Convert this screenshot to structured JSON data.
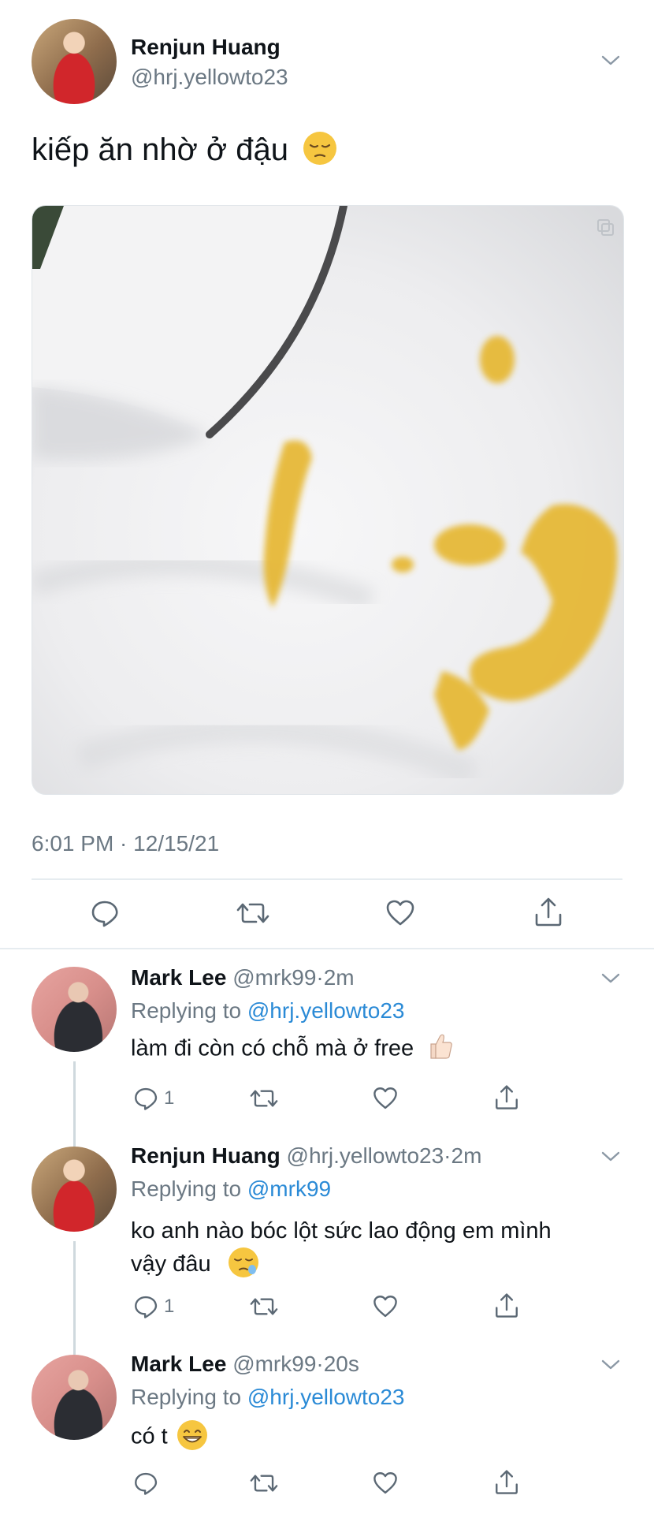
{
  "main_tweet": {
    "author_name": "Renjun Huang",
    "handle": "@hrj.yellowto23",
    "text": "kiếp ăn nhờ ở đậu",
    "emoji": "pensive-face",
    "timestamp": "6:01 PM · 12/15/21"
  },
  "replies": [
    {
      "author_name": "Mark Lee",
      "handle": "@mrk99",
      "time": "2m",
      "replying_label": "Replying to",
      "replying_to": "@hrj.yellowto23",
      "text": "làm đi còn có chỗ mà ở free",
      "emoji": "thumbs-up",
      "reply_count": "1"
    },
    {
      "author_name": "Renjun Huang",
      "handle": "@hrj.yellowto23",
      "time": "2m",
      "replying_label": "Replying to",
      "replying_to": "@mrk99",
      "text_line1": "ko anh nào bóc lột sức lao động em mình",
      "text_line2": "vậy đâu",
      "emoji": "sleepy-face",
      "reply_count": "1"
    },
    {
      "author_name": "Mark Lee",
      "handle": "@mrk99",
      "time": "20s",
      "replying_label": "Replying to",
      "replying_to": "@hrj.yellowto23",
      "text": "có t",
      "emoji": "grinning-face",
      "reply_count": ""
    }
  ],
  "separator": "·",
  "colors": {
    "link": "#2a8ad6",
    "muted": "#6b7883",
    "divider": "#e6ecf0"
  }
}
